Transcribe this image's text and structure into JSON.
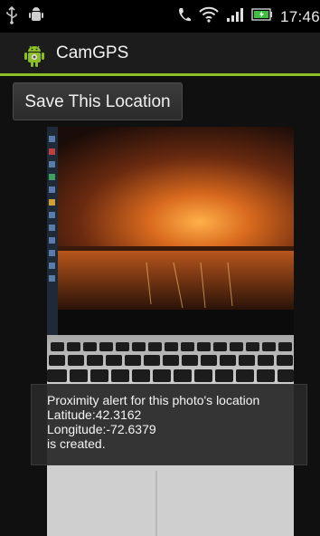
{
  "status_bar": {
    "time": "17:46",
    "icons": [
      "usb-icon",
      "android-debug-icon",
      "phone-icon",
      "wifi-icon",
      "signal-icon",
      "battery-icon"
    ]
  },
  "app": {
    "title": "CamGPS",
    "icon": "android-app-icon",
    "accent_color": "#8cbf26"
  },
  "main": {
    "save_button_label": "Save This Location",
    "photo": "captured-photo"
  },
  "toast": {
    "line1": "Proximity alert for this photo's location",
    "line2": "Latitude:42.3162",
    "line3": "Longitude:-72.6379",
    "line4": "is created."
  }
}
